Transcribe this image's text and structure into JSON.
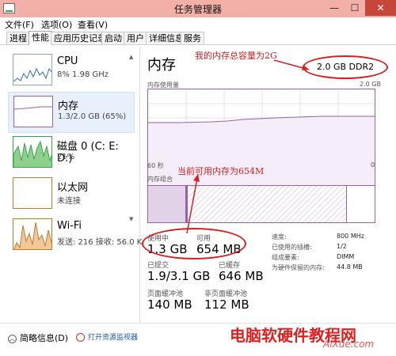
{
  "window": {
    "title": "任务管理器",
    "min_label": "—",
    "max_label": "☐",
    "close_label": "✕"
  },
  "menu": [
    {
      "label": "文件(F)"
    },
    {
      "label": "选项(O)"
    },
    {
      "label": "查看(V)"
    }
  ],
  "tabs": [
    {
      "label": "进程"
    },
    {
      "label": "性能"
    },
    {
      "label": "应用历史记录"
    },
    {
      "label": "启动"
    },
    {
      "label": "用户"
    },
    {
      "label": "详细信息"
    },
    {
      "label": "服务"
    }
  ],
  "sidebar": {
    "items": [
      {
        "title": "CPU",
        "sub": "8% 1.98 GHz"
      },
      {
        "title": "内存",
        "sub": "1.3/2.0 GB (65%)"
      },
      {
        "title": "磁盘 0 (C: E: D:)",
        "sub": "21%"
      },
      {
        "title": "以太网",
        "sub": "未连接"
      },
      {
        "title": "Wi-Fi",
        "sub": "发送: 216 接收: 56.0 K"
      }
    ]
  },
  "main": {
    "title": "内存",
    "capacity": "2.0 GB DDR2",
    "graph_label_left": "内存使用量",
    "graph_label_right": "2.0 GB",
    "axis_left": "60 秒",
    "axis_right": "0",
    "composition_label": "内存组合",
    "composition": {
      "in_use_gb": 1.3,
      "available_mb": 654,
      "total_gb": 2.0
    }
  },
  "stats": {
    "in_use_label": "使用中",
    "in_use_value": "1.3 GB",
    "available_label": "可用",
    "available_value": "654 MB",
    "committed_label": "已提交",
    "committed_value": "1.9/3.1 GB",
    "cached_label": "已缓存",
    "cached_value": "646 MB",
    "paged_label": "页面缓冲池",
    "paged_value": "140 MB",
    "nonpaged_label": "非页面缓冲池",
    "nonpaged_value": "112 MB"
  },
  "right_table": [
    {
      "key": "速度:",
      "val": "800 MHz"
    },
    {
      "key": "已使用的插槽:",
      "val": "1/2"
    },
    {
      "key": "组成要素:",
      "val": "DIMM"
    },
    {
      "key": "为硬件保留的内存:",
      "val": "44.8 MB"
    }
  ],
  "bottom": {
    "fewer_details": "简略信息(D)",
    "open_monitor": "打开资源监视器"
  },
  "annotations": {
    "top": "我的内存总容量为2G",
    "middle": "当前可用内存为654M"
  },
  "watermark": {
    "text": "电脑软硬件教程网",
    "sub": "AiXue.com"
  },
  "colors": {
    "accent_purple": "#9a5fa8",
    "annotation_red": "#d42020",
    "titlebar": "#f2b0a8",
    "close_red": "#c7463a"
  }
}
